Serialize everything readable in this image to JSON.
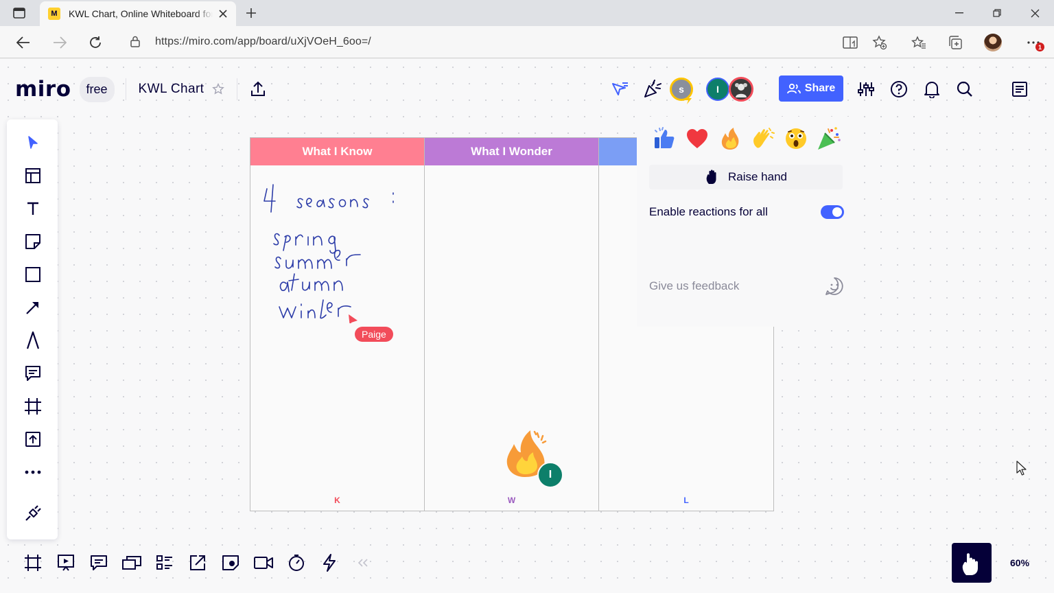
{
  "browser": {
    "tab_title": "KWL Chart, Online Whiteboard for Visual Collaboration",
    "favicon_letter": "M",
    "url": "https://miro.com/app/board/uXjVOeH_6oo=/",
    "notification_count": "1"
  },
  "board": {
    "logo": "miro",
    "plan_badge": "free",
    "name": "KWL Chart",
    "share_label": "Share",
    "zoom": "60%",
    "collaborators": [
      {
        "initial": "s",
        "color": "#8a8f9c"
      },
      {
        "initial": "I",
        "color": "#0d7f6a"
      }
    ]
  },
  "kwl": {
    "columns": [
      {
        "header": "What I Know",
        "footer": "K",
        "color": "#ff7f91",
        "footer_color": "#f24c5a"
      },
      {
        "header": "What I Wonder",
        "footer": "W",
        "color": "#bc7ad6",
        "footer_color": "#9b5bbf"
      },
      {
        "header": "",
        "footer": "L",
        "color": "#7b9ef5",
        "footer_color": "#4262ff"
      }
    ],
    "handwriting": [
      "4 seasons:",
      "spring",
      "summer",
      "atumn",
      "winter"
    ],
    "cursor_label": "Paige",
    "reaction_avatar_initial": "I"
  },
  "reactions_panel": {
    "emojis": [
      "thumbs-up",
      "heart",
      "fire",
      "clapping-hands",
      "astonished-face",
      "party-popper"
    ],
    "raise_hand_label": "Raise hand",
    "enable_label": "Enable reactions for all",
    "enabled": true,
    "feedback_label": "Give us feedback"
  }
}
